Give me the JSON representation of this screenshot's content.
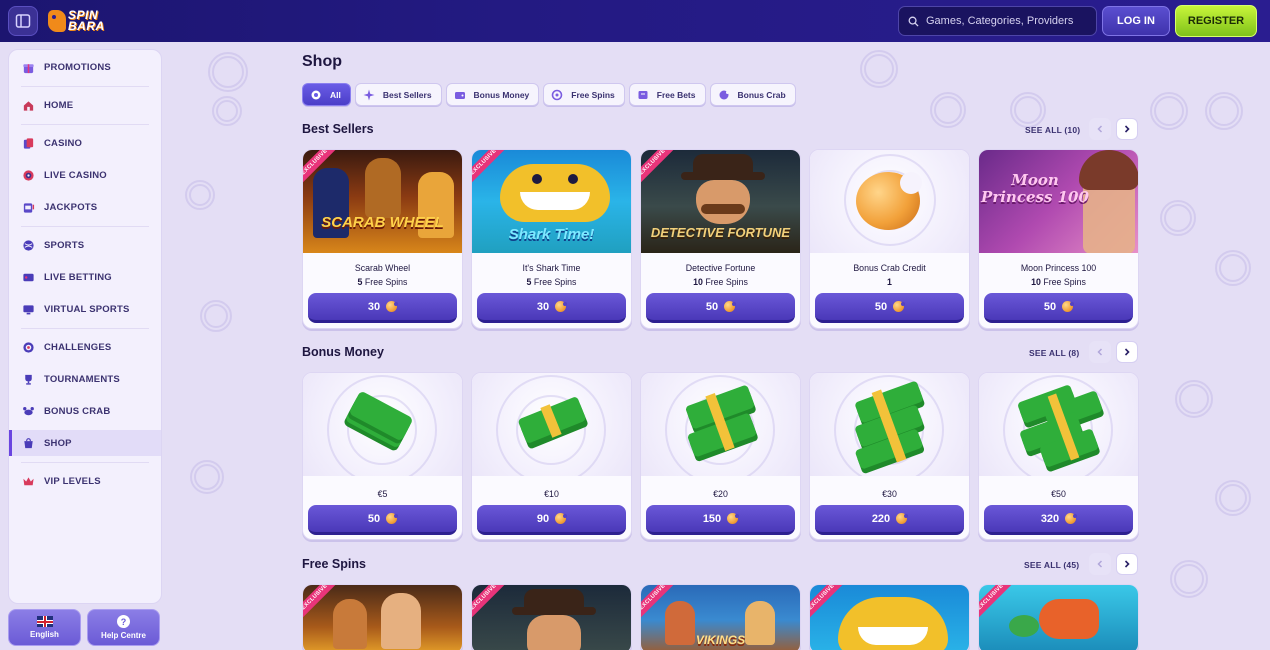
{
  "header": {
    "logo_line1": "SPIN",
    "logo_line2": "BARA",
    "search_placeholder": "Games, Categories, Providers",
    "login_label": "LOG IN",
    "register_label": "REGISTER"
  },
  "sidebar": {
    "items": [
      {
        "label": "PROMOTIONS",
        "icon": "gift-icon"
      },
      {
        "label": "HOME",
        "icon": "home-icon"
      },
      {
        "label": "CASINO",
        "icon": "cards-icon"
      },
      {
        "label": "LIVE CASINO",
        "icon": "roulette-icon"
      },
      {
        "label": "JACKPOTS",
        "icon": "slot-icon"
      },
      {
        "label": "SPORTS",
        "icon": "ball-icon"
      },
      {
        "label": "LIVE BETTING",
        "icon": "live-icon"
      },
      {
        "label": "VIRTUAL SPORTS",
        "icon": "monitor-icon"
      },
      {
        "label": "CHALLENGES",
        "icon": "target-icon"
      },
      {
        "label": "TOURNAMENTS",
        "icon": "trophy-icon"
      },
      {
        "label": "BONUS CRAB",
        "icon": "crab-icon"
      },
      {
        "label": "SHOP",
        "icon": "shop-icon",
        "active": true
      },
      {
        "label": "VIP LEVELS",
        "icon": "crown-icon"
      }
    ],
    "language_label": "English",
    "help_label": "Help Centre"
  },
  "main": {
    "title": "Shop",
    "filters": [
      {
        "label": "All",
        "active": true
      },
      {
        "label": "Best Sellers"
      },
      {
        "label": "Bonus Money"
      },
      {
        "label": "Free Spins"
      },
      {
        "label": "Free Bets"
      },
      {
        "label": "Bonus Crab"
      }
    ],
    "sections": [
      {
        "title": "Best Sellers",
        "see_all": "SEE ALL (10)",
        "items": [
          {
            "name": "Scarab Wheel",
            "qty": "5",
            "unit": "Free Spins",
            "price": "30",
            "badge": "EXCLUSIVE",
            "art": "SCARAB WHEEL"
          },
          {
            "name": "It's Shark Time",
            "qty": "5",
            "unit": "Free Spins",
            "price": "30",
            "badge": "EXCLUSIVE",
            "art": "Shark Time!"
          },
          {
            "name": "Detective Fortune",
            "qty": "10",
            "unit": "Free Spins",
            "price": "50",
            "badge": "EXCLUSIVE",
            "art": "DETECTIVE FORTUNE"
          },
          {
            "name": "Bonus Crab Credit",
            "qty": "1",
            "unit": "",
            "price": "50",
            "badge": "",
            "art": ""
          },
          {
            "name": "Moon Princess 100",
            "qty": "10",
            "unit": "Free Spins",
            "price": "50",
            "badge": "",
            "art": "Moon Princess 100"
          }
        ]
      },
      {
        "title": "Bonus Money",
        "see_all": "SEE ALL (8)",
        "items": [
          {
            "name": "€5",
            "price": "50",
            "stacks": 1
          },
          {
            "name": "€10",
            "price": "90",
            "stacks": 1
          },
          {
            "name": "€20",
            "price": "150",
            "stacks": 2
          },
          {
            "name": "€30",
            "price": "220",
            "stacks": 3
          },
          {
            "name": "€50",
            "price": "320",
            "stacks": 4
          }
        ]
      },
      {
        "title": "Free Spins",
        "see_all": "SEE ALL (45)",
        "items": [
          {
            "badge": "EXCLUSIVE"
          },
          {
            "badge": "EXCLUSIVE"
          },
          {
            "badge": "EXCLUSIVE",
            "art": "VIKINGS"
          },
          {
            "badge": "EXCLUSIVE"
          },
          {
            "badge": "EXCLUSIVE"
          }
        ]
      }
    ]
  },
  "colors": {
    "topbar": "#231a82",
    "accent": "#5b4fd0",
    "register": "#9ad624",
    "exclusive": "#e8347a",
    "page_bg": "#e4def5"
  }
}
